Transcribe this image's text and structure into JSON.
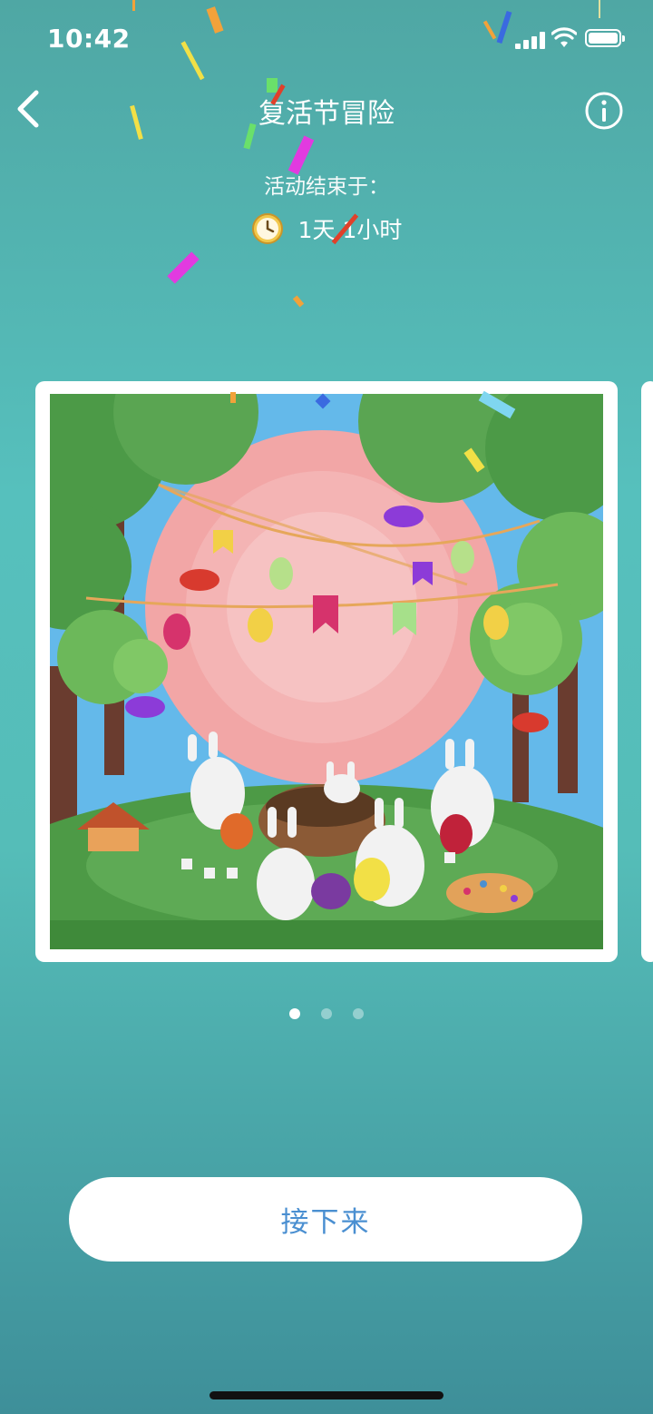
{
  "status": {
    "time": "10:42"
  },
  "header": {
    "title": "复活节冒险",
    "back_icon": "chevron-left-icon",
    "info_icon": "info-circle-icon"
  },
  "event": {
    "ends_label": "活动结束于：",
    "countdown": "1天 1小时",
    "clock_icon": "clock-icon"
  },
  "carousel": {
    "page_count": 3,
    "active_index": 0,
    "image": "Easter pixel-art scene"
  },
  "actions": {
    "next_label": "接下来"
  },
  "colors": {
    "accent": "#4a8fd1",
    "background": "#56c0bd"
  }
}
